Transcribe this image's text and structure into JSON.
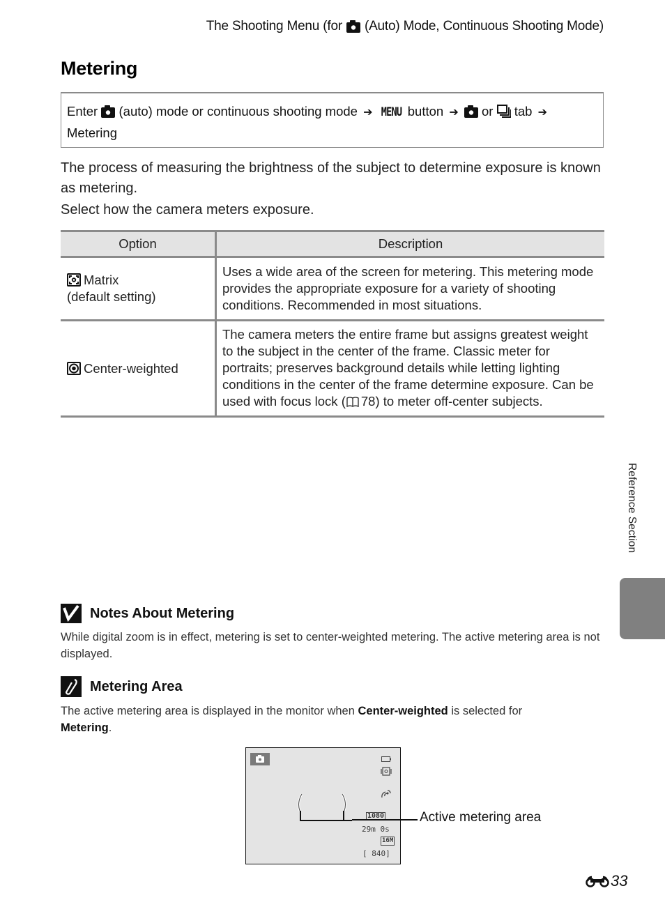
{
  "running_head": {
    "before_icon": "The Shooting Menu (for",
    "icon": "camera-auto-icon",
    "after_icon": "(Auto) Mode, Continuous Shooting Mode)"
  },
  "page_title": "Metering",
  "navigation": {
    "parts": [
      "Enter",
      "(auto) mode or continuous shooting mode",
      "MENU",
      "button",
      "or",
      "tab",
      "Metering"
    ],
    "arrow": "➔"
  },
  "intro": {
    "paragraph_1": "The process of measuring the brightness of the subject to determine exposure is known as metering.",
    "paragraph_2": "Select how the camera meters exposure."
  },
  "options_table": {
    "headers": [
      "Option",
      "Description"
    ],
    "rows": [
      {
        "icon": "matrix-metering-icon",
        "option_line1": "Matrix",
        "option_line2": "(default setting)",
        "description": "Uses a wide area of the screen for metering. This metering mode provides the appropriate exposure for a variety of shooting conditions. Recommended in most situations."
      },
      {
        "icon": "center-weighted-metering-icon",
        "option_line1": "Center-weighted",
        "description_before_ref": "The camera meters the entire frame but assigns greatest weight to the subject in the center of the frame. Classic meter for portraits; preserves background details while letting lighting conditions in the center of the frame determine exposure. Can be used with focus lock (",
        "ref_page": "78",
        "description_after_ref": ") to meter off-center subjects."
      }
    ]
  },
  "notes": [
    {
      "icon": "caution-check-icon",
      "title": "Notes About Metering",
      "text": "While digital zoom is in effect, metering is set to center-weighted metering. The active metering area is not displayed."
    },
    {
      "icon": "pencil-note-icon",
      "title": "Metering Area",
      "text_before": "The active metering area is displayed in the monitor when ",
      "bold_1": "Center-weighted",
      "text_middle": " is selected for ",
      "bold_2": "Metering",
      "text_after": "."
    }
  ],
  "monitor_illustration": {
    "video_mode": "1080",
    "remaining_time": "29m 0s",
    "image_size": "16M",
    "shots_remaining": "[ 840]",
    "callout": "Active metering area"
  },
  "side_tab": {
    "label": "Reference Section"
  },
  "page_number": {
    "prefix_icon": "reference-section-icon",
    "number": "33"
  }
}
